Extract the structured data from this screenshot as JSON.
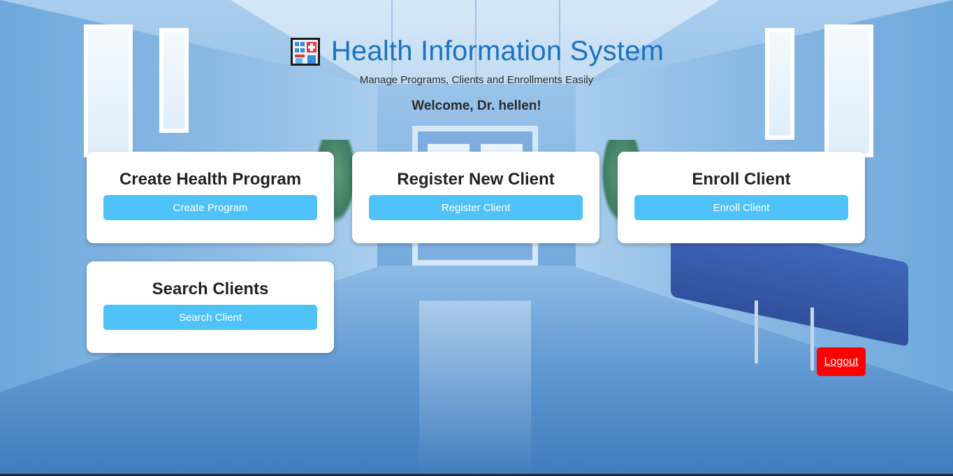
{
  "header": {
    "title": "Health Information System",
    "subtitle": "Manage Programs, Clients and Enrollments Easily",
    "welcome": "Welcome, Dr. hellen!",
    "icon": "hospital-icon"
  },
  "cards": [
    {
      "title": "Create Health Program",
      "button_label": "Create Program"
    },
    {
      "title": "Register New Client",
      "button_label": "Register Client"
    },
    {
      "title": "Enroll Client",
      "button_label": "Enroll Client"
    },
    {
      "title": "Search Clients",
      "button_label": "Search Client"
    }
  ],
  "logout_label": "Logout",
  "colors": {
    "title": "#1a73c2",
    "card_button": "#4fc3f7",
    "logout_button": "#ff0000",
    "card_background": "#ffffff"
  }
}
